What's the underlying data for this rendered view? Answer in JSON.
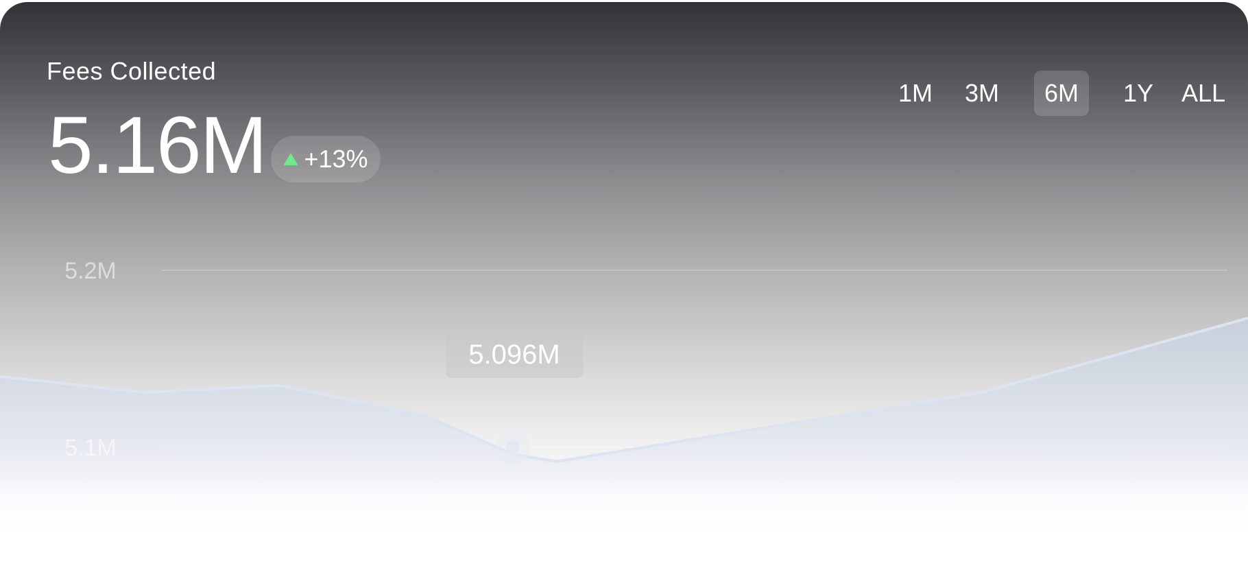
{
  "header": {
    "title": "Fees Collected",
    "value": "5.16M",
    "change": "+13%",
    "change_icon": "triangle-up-icon",
    "change_color": "#6ee88a"
  },
  "ranges": [
    {
      "label": "1M",
      "active": false
    },
    {
      "label": "3M",
      "active": false
    },
    {
      "label": "6M",
      "active": true
    },
    {
      "label": "1Y",
      "active": false
    },
    {
      "label": "ALL",
      "active": false
    }
  ],
  "tooltip": {
    "label": "5.096M",
    "point_index": 4
  },
  "colors": {
    "line": "#dbe4f1",
    "area": "#c9d3e3"
  },
  "chart_data": {
    "type": "area",
    "title": "Fees Collected",
    "xlabel": "",
    "ylabel": "",
    "x": [
      0,
      1,
      2,
      3,
      4,
      5,
      6,
      7
    ],
    "series": [
      {
        "values": [
          5.14,
          5.131,
          5.135,
          5.118,
          5.096,
          5.092,
          5.131,
          5.173
        ]
      }
    ],
    "ylim": [
      5.05,
      5.26
    ],
    "yticks": [
      5.2,
      5.1
    ],
    "ytick_labels": [
      "5.2M",
      "5.1M"
    ],
    "grid": true,
    "legend": "none"
  }
}
